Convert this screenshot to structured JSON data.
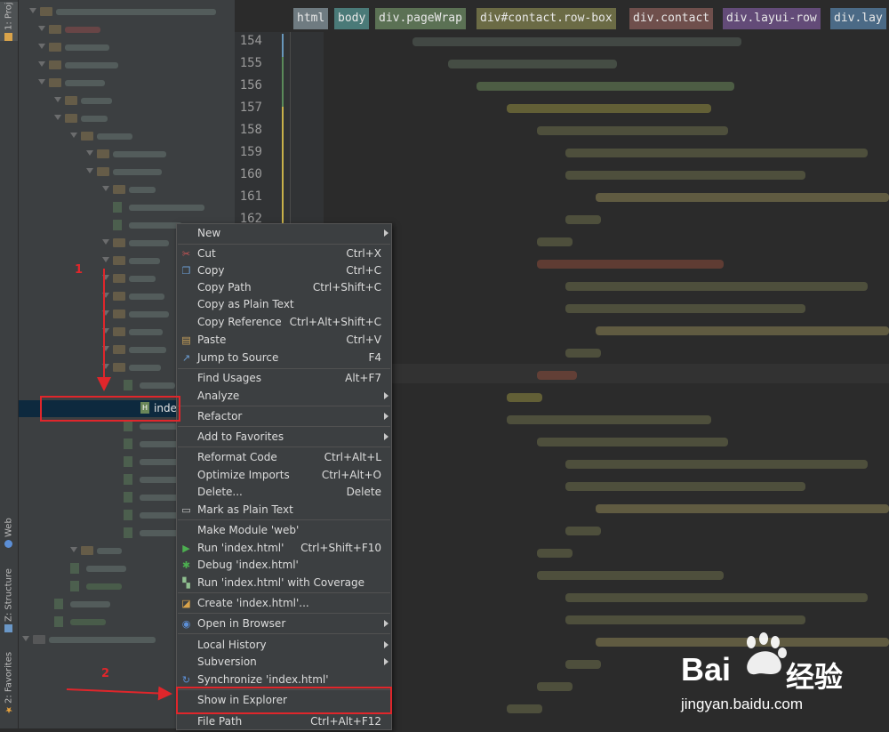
{
  "side_tabs": {
    "project": "1: Proj",
    "web": "Web",
    "structure": "Z: Structure",
    "favorites": "2: Favorites"
  },
  "project_tree": {
    "selected_file": "index.htm"
  },
  "breadcrumbs": [
    "html",
    "body",
    "div.pageWrap",
    "div#contact.row-box",
    "div.contact",
    "div.layui-row",
    "div.lay"
  ],
  "line_numbers": [
    "154",
    "155",
    "156",
    "157",
    "158",
    "159",
    "160",
    "161",
    "162"
  ],
  "context_menu": {
    "new": "New",
    "cut": "Cut",
    "cut_sc": "Ctrl+X",
    "copy": "Copy",
    "copy_sc": "Ctrl+C",
    "copy_path": "Copy Path",
    "copy_path_sc": "Ctrl+Shift+C",
    "copy_plain": "Copy as Plain Text",
    "copy_ref": "Copy Reference",
    "copy_ref_sc": "Ctrl+Alt+Shift+C",
    "paste": "Paste",
    "paste_sc": "Ctrl+V",
    "jump": "Jump to Source",
    "jump_sc": "F4",
    "find_usages": "Find Usages",
    "find_usages_sc": "Alt+F7",
    "analyze": "Analyze",
    "refactor": "Refactor",
    "add_fav": "Add to Favorites",
    "reformat": "Reformat Code",
    "reformat_sc": "Ctrl+Alt+L",
    "optimize": "Optimize Imports",
    "optimize_sc": "Ctrl+Alt+O",
    "delete": "Delete...",
    "delete_sc": "Delete",
    "mark_plain": "Mark as Plain Text",
    "make_module": "Make Module 'web'",
    "run": "Run 'index.html'",
    "run_sc": "Ctrl+Shift+F10",
    "debug": "Debug 'index.html'",
    "run_cov": "Run 'index.html' with Coverage",
    "create": "Create 'index.html'...",
    "open_browser": "Open in Browser",
    "local_history": "Local History",
    "subversion": "Subversion",
    "sync": "Synchronize 'index.html'",
    "show_explorer": "Show in Explorer",
    "file_path": "File Path",
    "file_path_sc": "Ctrl+Alt+F12"
  },
  "annotations": {
    "step1": "1",
    "step2": "2"
  },
  "watermark": {
    "brand_left": "Bai",
    "brand_right": "经验",
    "url": "jingyan.baidu.com"
  },
  "colors": {
    "annotation_red": "#e0262b",
    "menu_bg": "#3c3f41",
    "editor_bg": "#2b2b2b"
  }
}
